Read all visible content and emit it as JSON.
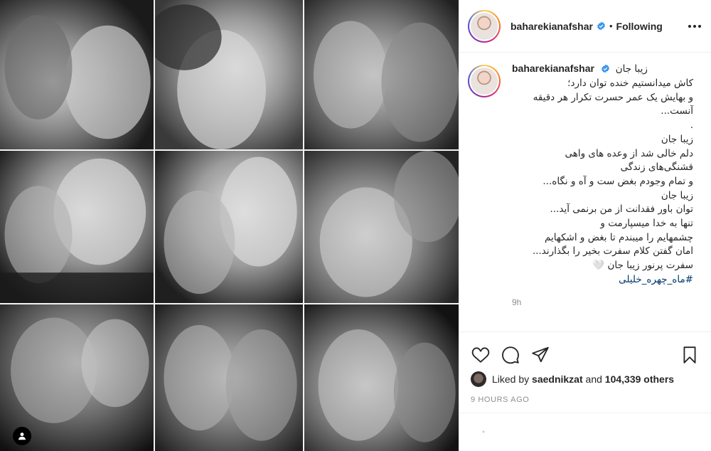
{
  "post": {
    "username": "baharekianafshar",
    "follow_status": "Following",
    "caption_first_line": "زیبا جان",
    "caption_lines": [
      "کاش میدانستیم خنده توان دارد؛",
      "و بهایش یک عمر حسرت تکرار هر دقیقه",
      "آنست...",
      ".",
      "زیبا جان",
      "دلم خالی شد از وعده های واهی",
      "قشنگی‌های زندگی",
      "و تمام وجودم بغض ست و آه و نگاه...",
      "زیبا جان",
      "توان باور فقدانت از من برنمی آید...",
      "تنها به خدا میسپارمت و",
      "چشمهایم را میبندم تا بغض و اشکهایم",
      "امان گفتن کلام سفرت بخیر را بگذارند...",
      "سفرت پرنور زیبا جان 🤍"
    ],
    "hashtag": "#ماه_چهره_خلیلی",
    "caption_age": "9h",
    "liked_by_prefix": "Liked by",
    "liked_by_user": "saednikzat",
    "liked_by_and": "and",
    "likes_count": "104,339 others",
    "post_age": "9 HOURS AGO"
  },
  "icons": {
    "like": "heart-icon",
    "comment": "comment-icon",
    "share": "share-icon",
    "save": "bookmark-icon",
    "options": "more-options-icon",
    "verified": "verified-badge-icon",
    "tagged": "user-tag-icon"
  },
  "colors": {
    "accent_blue": "#3897f0",
    "text": "#262626",
    "muted": "#8e8e8e",
    "hashtag": "#00376b"
  }
}
